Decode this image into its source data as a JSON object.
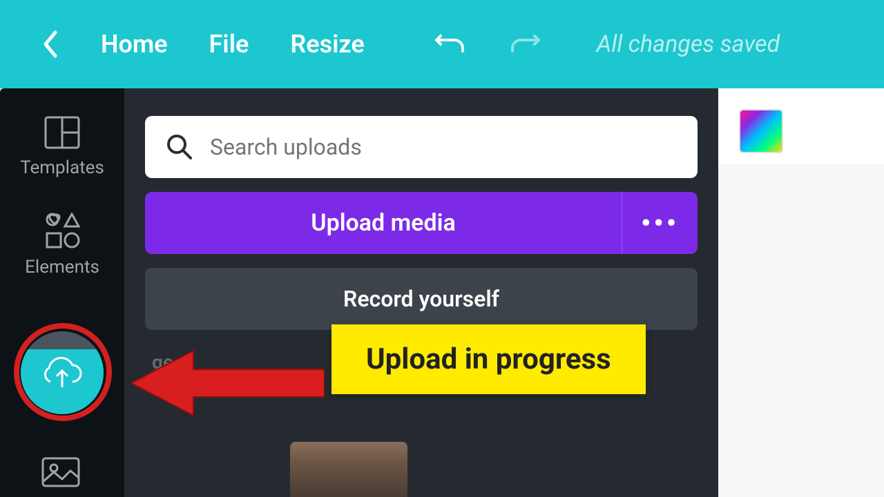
{
  "topbar": {
    "home": "Home",
    "file": "File",
    "resize": "Resize",
    "status": "All changes saved"
  },
  "sidepanel": {
    "templates": "Templates",
    "elements": "Elements"
  },
  "panel": {
    "search_placeholder": "Search uploads",
    "upload_label": "Upload media",
    "more": "•••",
    "record_label": "Record yourself",
    "tab_images": "ges"
  },
  "callout": {
    "text": "Upload in progress"
  }
}
